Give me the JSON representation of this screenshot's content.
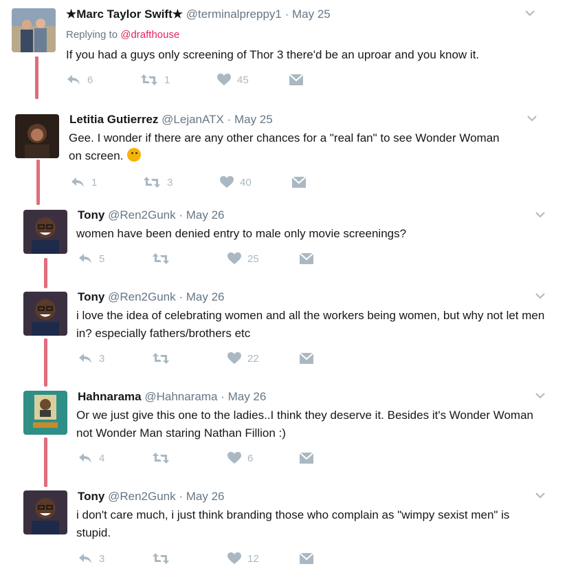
{
  "colors": {
    "thread_line": "#e06d7d",
    "icon_gray": "#aab8c2",
    "mention": "#e0245e"
  },
  "icons": {
    "reply": "reply-icon",
    "retweet": "retweet-icon",
    "like": "heart-icon",
    "dm": "message-icon",
    "caret": "chevron-down-icon"
  },
  "tweets": [
    {
      "name": "★Marc Taylor Swift★",
      "handle": "@terminalpreppy1",
      "date": "May 25",
      "replying_label": "Replying to",
      "replying_to": "@drafthouse",
      "text": "If you had a guys only screening of Thor 3 there'd be an uproar and you know it.",
      "replies": "6",
      "retweets": "1",
      "likes": "45"
    },
    {
      "name": "Letitia Gutierrez",
      "handle": "@LejanATX",
      "date": "May 25",
      "text": "Gee. I wonder if there are any other chances for a \"real fan\" to see Wonder Woman on screen.",
      "replies": "1",
      "retweets": "3",
      "likes": "40"
    },
    {
      "name": "Tony",
      "handle": "@Ren2Gunk",
      "date": "May 26",
      "text": "women have been denied entry to male only movie screenings?",
      "replies": "5",
      "retweets": "",
      "likes": "25"
    },
    {
      "name": "Tony",
      "handle": "@Ren2Gunk",
      "date": "May 26",
      "text": "i love the idea of celebrating women and all the workers being women, but why not let men in? especially fathers/brothers etc",
      "replies": "3",
      "retweets": "",
      "likes": "22"
    },
    {
      "name": "Hahnarama",
      "handle": "@Hahnarama",
      "date": "May 26",
      "text": "Or we just give this one to the ladies..I think they deserve it. Besides it's Wonder Woman not Wonder Man staring Nathan Fillion :)",
      "replies": "4",
      "retweets": "",
      "likes": "6"
    },
    {
      "name": "Tony",
      "handle": "@Ren2Gunk",
      "date": "May 26",
      "text": "i don't care much, i just think branding those who complain as \"wimpy sexist men\" is stupid.",
      "replies": "3",
      "retweets": "",
      "likes": "12"
    }
  ]
}
